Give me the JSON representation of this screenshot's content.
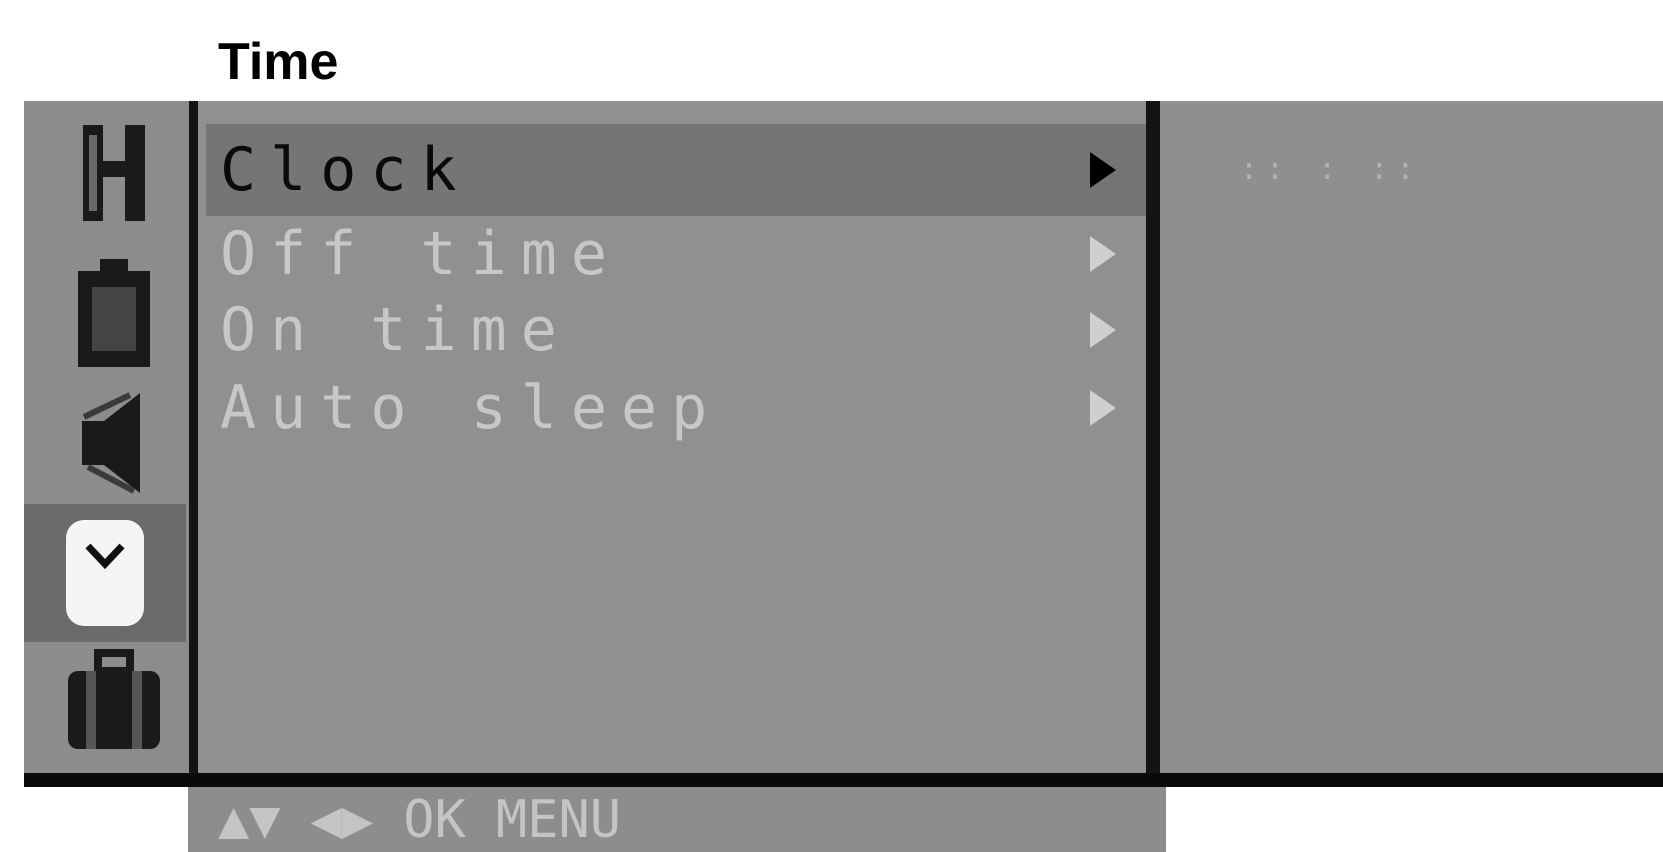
{
  "page": {
    "title": "Time"
  },
  "sidebar": {
    "icons": [
      {
        "name": "picture-icon"
      },
      {
        "name": "battery-icon"
      },
      {
        "name": "sound-icon"
      },
      {
        "name": "clock-icon",
        "selected": true
      },
      {
        "name": "briefcase-icon"
      }
    ]
  },
  "menu": {
    "items": [
      {
        "label": "Clock",
        "selected": true
      },
      {
        "label": "Off time"
      },
      {
        "label": "On time"
      },
      {
        "label": "Auto sleep"
      }
    ]
  },
  "right_panel": {
    "clock_value": ":: : ::"
  },
  "nav": {
    "updown": "▲▼",
    "leftright": "◀▶",
    "ok": "OK",
    "menu": "MENU"
  },
  "colors": {
    "osd_bg": "#8f8f8f",
    "selected_bg": "#757575",
    "border": "#141414"
  }
}
